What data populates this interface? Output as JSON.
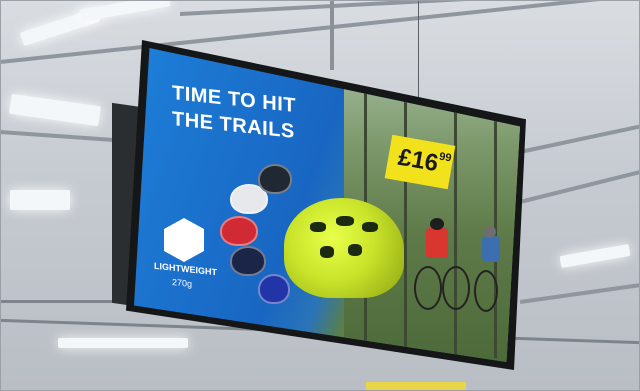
{
  "scene": {
    "description_colors": {
      "screen_blue": "#1e7fd8",
      "helmet_yellow": "#d6ef2d",
      "price_yellow": "#f2e21b"
    }
  },
  "ad": {
    "headline_line1": "TIME TO HIT",
    "headline_line2": "THE TRAILS",
    "price_main": "£16",
    "price_cents": "99",
    "caption": "",
    "badge": {
      "label": "LIGHTWEIGHT",
      "sub": "270g",
      "icon": "helmet-icon"
    }
  }
}
